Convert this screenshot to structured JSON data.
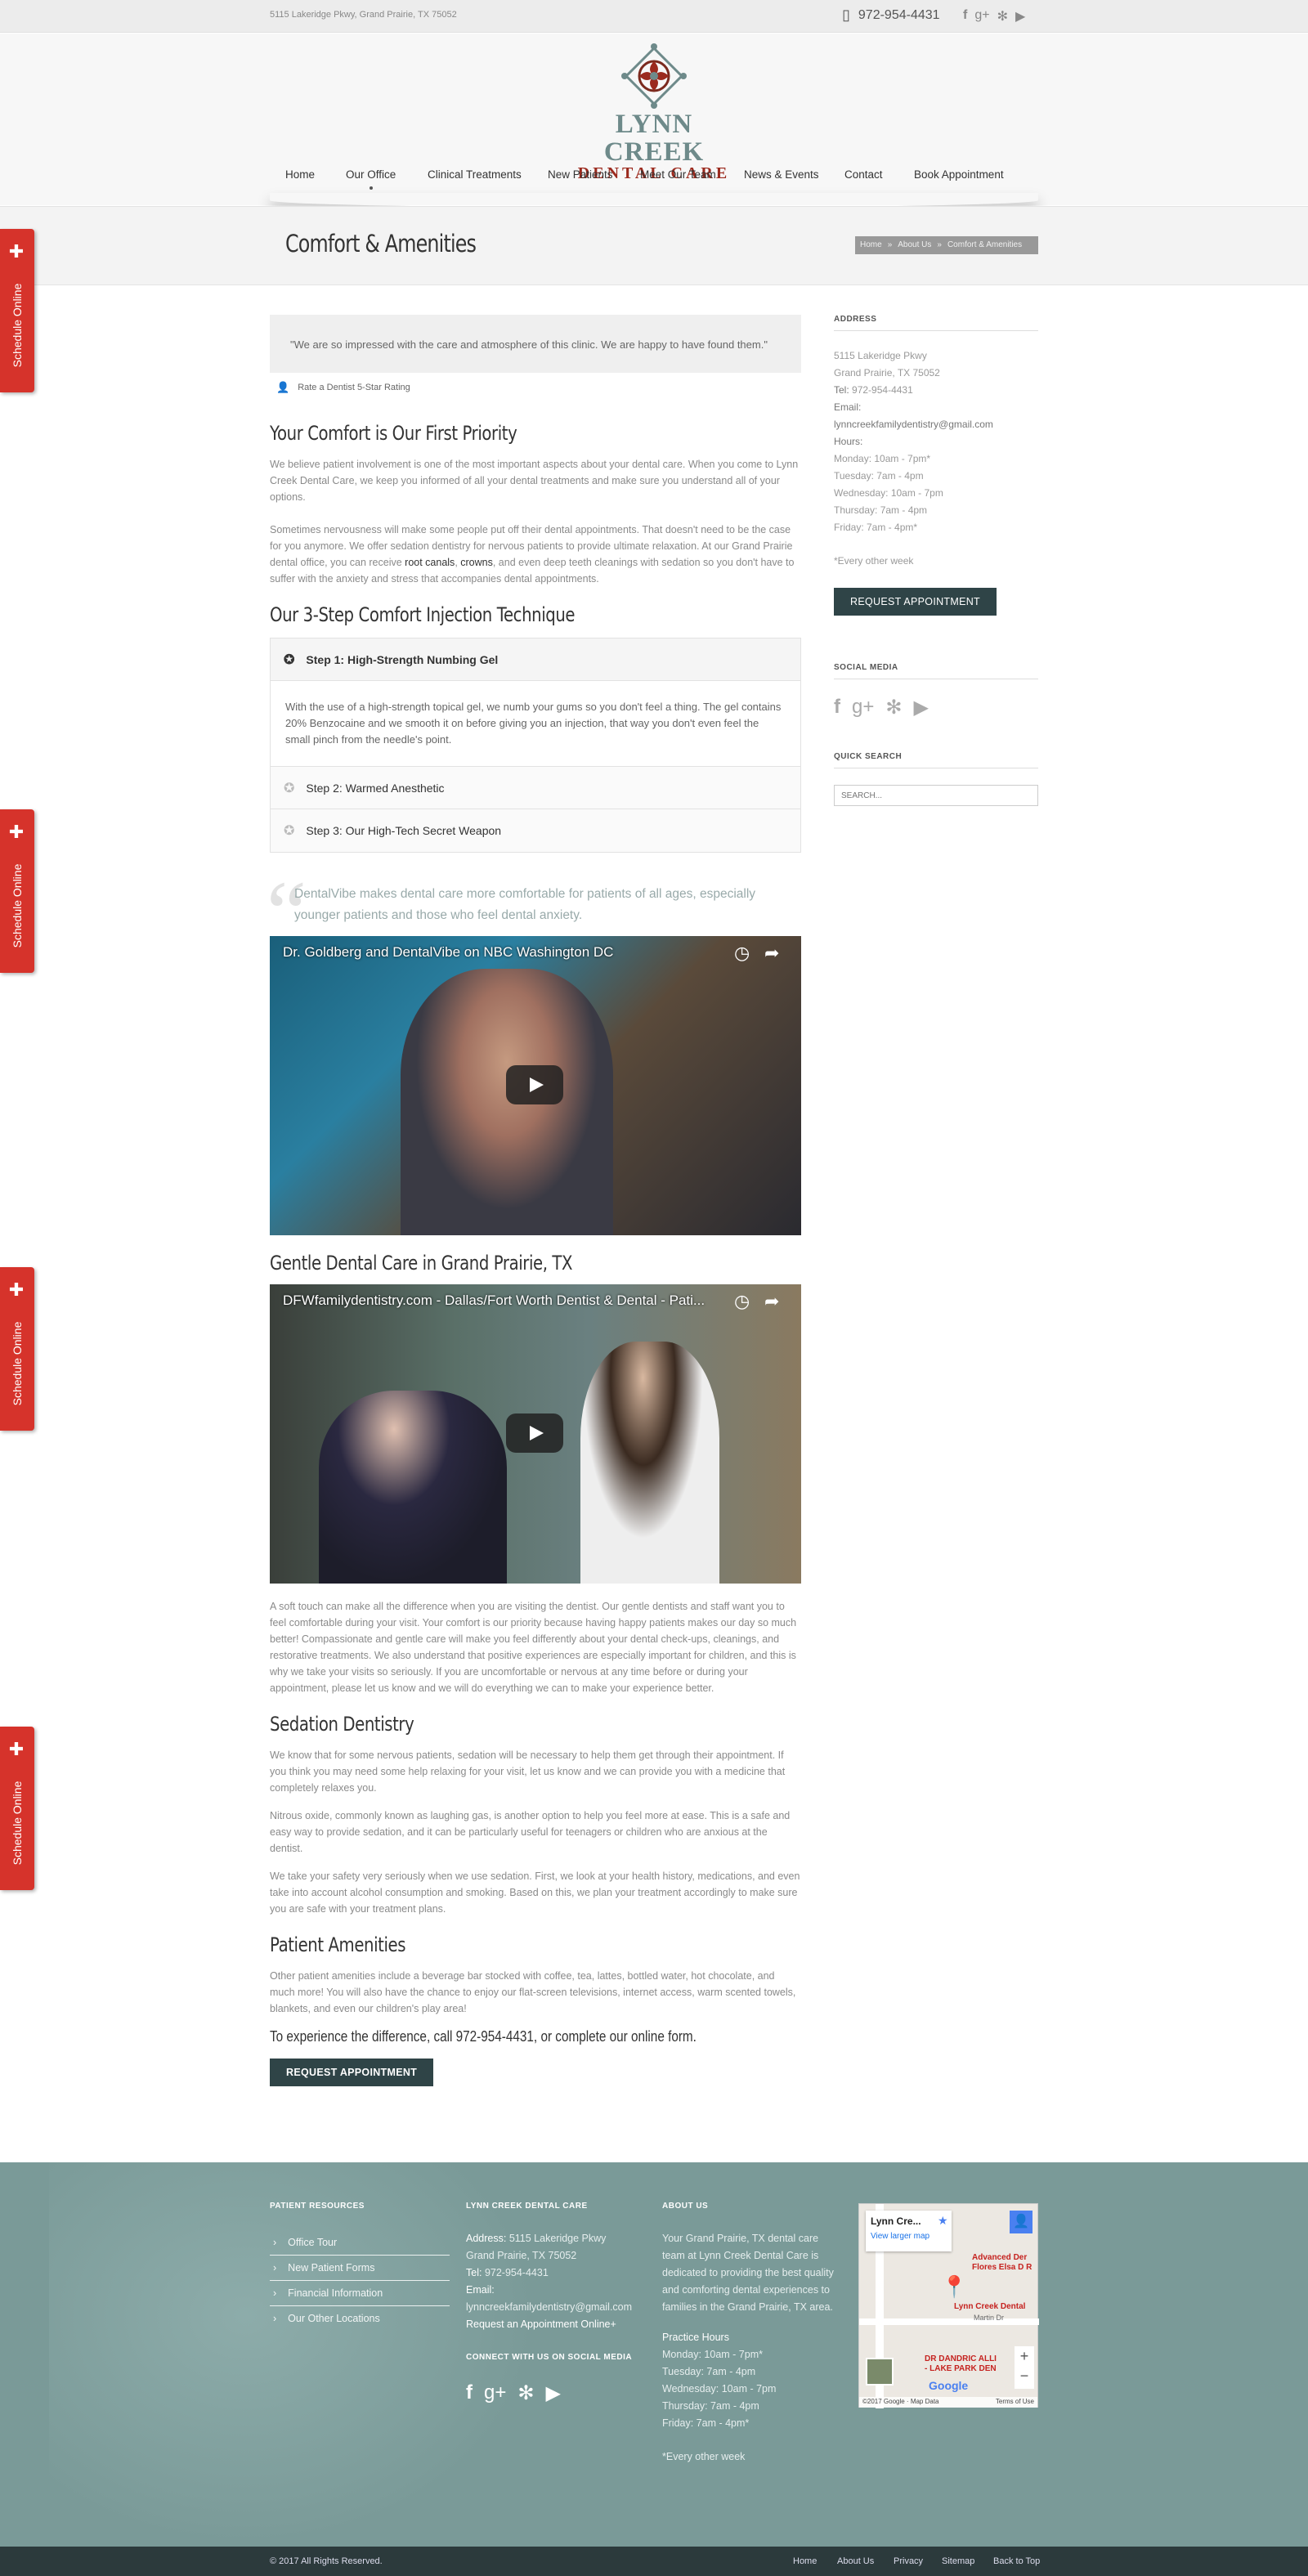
{
  "topbar": {
    "address": "5115 Lakeridge Pkwy, Grand Prairie, TX 75052",
    "phone": "972-954-4431"
  },
  "logo": {
    "line1": "LYNN CREEK",
    "line2": "DENTAL CARE"
  },
  "nav": [
    "Home",
    "Our Office",
    "Clinical Treatments",
    "New Patients",
    "Meet Our Team",
    "News & Events",
    "Contact",
    "Book Appointment"
  ],
  "page_title": "Comfort & Amenities",
  "breadcrumb": [
    "Home",
    "About Us",
    "Comfort & Amenities"
  ],
  "schedule_tab": "Schedule Online",
  "testimonial": "\"We are so impressed with the care and atmosphere of this clinic. We are happy to have found them.\"",
  "rating_link": "Rate a Dentist 5-Star Rating",
  "s1": {
    "title": "Your Comfort is Our First Priority",
    "p1": "We believe patient involvement is one of the most important aspects about your dental care. When you come to Lynn Creek Dental Care, we keep you informed of all your dental treatments and make sure you understand all of your options.",
    "p2a": "Sometimes nervousness will make some people put off their dental appointments. That doesn't need to be the case for you anymore. We offer sedation dentistry for nervous patients to provide ultimate relaxation. At our Grand Prairie dental office, you can receive ",
    "link1": "root canals",
    "comma": ", ",
    "link2": "crowns",
    "p2b": ", and even deep teeth cleanings with sedation so you don't have to suffer with the anxiety and stress that accompanies dental appointments."
  },
  "s2": {
    "title": "Our 3-Step Comfort Injection Technique",
    "step1": "Step 1: High-Strength Numbing Gel",
    "step1_body": "With the use of a high-strength topical gel, we numb your gums so you don't feel a thing. The gel contains 20% Benzocaine and we smooth it on before giving you an injection, that way you don't even feel the small pinch from the needle's point.",
    "step2": "Step 2: Warmed Anesthetic",
    "step3": "Step 3: Our High-Tech Secret Weapon"
  },
  "blockquote": "DentalVibe makes dental care more comfortable for patients of all ages, especially younger patients and those who feel dental anxiety.",
  "video1": "Dr. Goldberg and DentalVibe on NBC Washington DC",
  "s3": {
    "title": "Gentle Dental Care in Grand Prairie, TX",
    "video": "DFWfamilydentistry.com - Dallas/Fort Worth Dentist & Dental - Pati...",
    "p": "A soft touch can make all the difference when you are visiting the dentist. Our gentle dentists and staff want you to feel comfortable during your visit. Your comfort is our priority because having happy patients makes our day so much better! Compassionate and gentle care will make you feel differently about your dental check-ups, cleanings, and restorative treatments. We also understand that positive experiences are especially important for children, and this is why we take your visits so seriously. If you are uncomfortable or nervous at any time before or during your appointment, please let us know and we will do everything we can to make your experience better."
  },
  "s4": {
    "title": "Sedation Dentistry",
    "p1": "We know that for some nervous patients, sedation will be necessary to help them get through their appointment. If you think you may need some help relaxing for your visit, let us know and we can provide you with a medicine that completely relaxes you.",
    "p2": "Nitrous oxide, commonly known as laughing gas, is another option to help you feel more at ease. This is a safe and easy way to provide sedation, and it can be particularly useful for teenagers or children who are anxious at the dentist.",
    "p3": "We take your safety very seriously when we use sedation. First, we look at your health history, medications, and even take into account alcohol consumption and smoking. Based on this, we plan your treatment accordingly to make sure you are safe with your treatment plans."
  },
  "s5": {
    "title": "Patient Amenities",
    "p": "Other patient amenities include a beverage bar stocked with coffee, tea, lattes, bottled water, hot chocolate, and much more! You will also have the chance to enjoy our flat-screen televisions, internet access, warm scented towels, blankets, and even our children's play area!",
    "cta": "To experience the difference, call 972-954-4431, or complete our online form."
  },
  "request_btn": "REQUEST APPOINTMENT",
  "sidebar": {
    "address_h": "ADDRESS",
    "lines": [
      "5115 Lakeridge Pkwy",
      "Grand Prairie, TX 75052"
    ],
    "tel_l": "Tel:",
    "tel": "972-954-4431",
    "email_l": "Email:",
    "email": "lynncreekfamilydentistry@gmail.com",
    "hours_l": "Hours:",
    "hours": [
      "Monday: 10am - 7pm*",
      "Tuesday: 7am - 4pm",
      "Wednesday: 10am - 7pm",
      "Thursday: 7am - 4pm",
      "Friday: 7am - 4pm*"
    ],
    "note": "*Every other week",
    "social_h": "SOCIAL MEDIA",
    "search_h": "QUICK SEARCH",
    "search_ph": "SEARCH..."
  },
  "footer": {
    "res_h": "PATIENT RESOURCES",
    "res": [
      "Office Tour",
      "New Patient Forms",
      "Financial Information",
      "Our Other Locations"
    ],
    "lc_h": "LYNN CREEK DENTAL CARE",
    "addr_l": "Address:",
    "addr1": "5115 Lakeridge Pkwy",
    "addr2": "Grand Prairie, TX 75052",
    "tel_l": "Tel:",
    "tel": "972-954-4431",
    "email_l": "Email:",
    "email": "lynncreekfamilydentistry@gmail.com",
    "req": "Request an Appointment Online+",
    "connect_h": "CONNECT WITH US ON SOCIAL MEDIA",
    "about_h": "ABOUT US",
    "about": "Your Grand Prairie, TX dental care team at Lynn Creek Dental Care is dedicated to providing the best quality and comforting dental experiences to families in the Grand Prairie, TX area.",
    "ph_h": "Practice Hours",
    "hours": [
      "Monday: 10am - 7pm*",
      "Tuesday: 7am - 4pm",
      "Wednesday: 10am - 7pm",
      "Thursday: 7am - 4pm",
      "Friday: 7am - 4pm*"
    ],
    "note": "*Every other week"
  },
  "map": {
    "place": "Lynn Cre...",
    "larger": "View larger map",
    "m1": "Advanced Der",
    "m2": "Flores Elsa D R",
    "m3": "Lynn Creek Dental",
    "m4": "DR DANDRIC ALLI",
    "m5": "- LAKE PARK DEN",
    "street": "Martin Dr",
    "google": "Google",
    "copy": "©2017 Google · Map Data",
    "terms": "Terms of Use"
  },
  "bottom": {
    "copyright": "© 2017 All Rights Reserved.",
    "links": [
      "Home",
      "About Us",
      "Privacy",
      "Sitemap",
      "Back to Top"
    ]
  }
}
